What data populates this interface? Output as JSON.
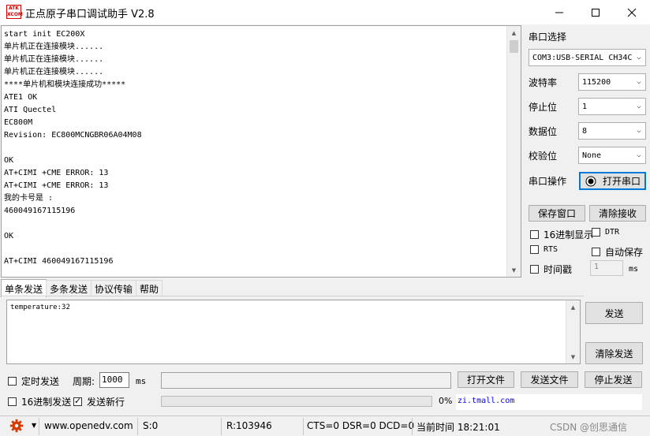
{
  "window": {
    "title": "正点原子串口调试助手 V2.8",
    "icon_line1": "ATK",
    "icon_line2": "XCOM",
    "minimize_icon": "minimize-icon",
    "maximize_icon": "maximize-icon",
    "close_icon": "close-icon"
  },
  "receive": {
    "lines": [
      "start init EC200X",
      "单片机正在连接模块......",
      "单片机正在连接模块......",
      "单片机正在连接模块......",
      "****单片机和模块连接成功*****",
      "ATE1 OK",
      "ATI Quectel",
      "EC800M",
      "Revision: EC800MCNGBR06A04M08",
      "",
      "OK",
      "AT+CIMI +CME ERROR: 13",
      "AT+CIMI +CME ERROR: 13",
      "我的卡号是 :",
      "460049167115196",
      "",
      "OK",
      "",
      "AT+CIMI 460049167115196"
    ]
  },
  "serial": {
    "port_label": "串口选择",
    "port_value": "COM3:USB-SERIAL CH34C",
    "baud_label": "波特率",
    "baud_value": "115200",
    "stopbit_label": "停止位",
    "stopbit_value": "1",
    "databit_label": "数据位",
    "databit_value": "8",
    "parity_label": "校验位",
    "parity_value": "None",
    "op_label": "串口操作",
    "open_button": "打开串口",
    "save_window": "保存窗口",
    "clear_receive": "清除接收",
    "hex_display": "16进制显示",
    "dtr": "DTR",
    "rts": "RTS",
    "auto_save": "自动保存",
    "timestamp": "时间戳",
    "timestamp_value": "1",
    "ms_unit": "ms"
  },
  "tabs": [
    "单条发送",
    "多条发送",
    "协议传输",
    "帮助"
  ],
  "send": {
    "text": "temperature:32",
    "send_button": "发送",
    "clear_send": "清除发送",
    "timed_send": "定时发送",
    "period_label": "周期:",
    "period_value": "1000",
    "ms_unit": "ms",
    "open_file": "打开文件",
    "send_file": "发送文件",
    "stop_send": "停止发送",
    "hex_send": "16进制发送",
    "send_newline": "发送新行",
    "progress_text": "0%",
    "progress": 0,
    "link_text": "zi.tmall.com"
  },
  "status": {
    "settings_icon": "gear-icon",
    "url": "www.openedv.com",
    "sent": "S:0",
    "received": "R:103946",
    "lines": "CTS=0 DSR=0 DCD=0",
    "time_label": "当前时间 18:21:01",
    "watermark": "CSDN @创思通信"
  },
  "colors": {
    "gear": "#d83b01",
    "accent_border": "#0078d7",
    "link": "#0000ee"
  }
}
